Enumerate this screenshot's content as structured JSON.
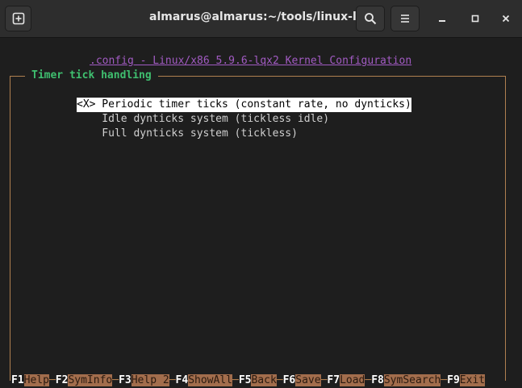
{
  "header": {
    "title": "almarus@almarus:~/tools/linux-lqx"
  },
  "terminal": {
    "config_title": ".config - Linux/x86 5.9.6-lqx2 Kernel Configuration",
    "box_title": "Timer tick handling",
    "options": [
      {
        "text": "<X> Periodic timer ticks (constant rate, no dynticks)",
        "selected": true
      },
      {
        "text": "    Idle dynticks system (tickless idle)",
        "selected": false
      },
      {
        "text": "    Full dynticks system (tickless)",
        "selected": false
      }
    ],
    "function_keys": [
      {
        "key": "F1",
        "label": "Help"
      },
      {
        "key": "F2",
        "label": "SymInfo"
      },
      {
        "key": "F3",
        "label": "Help 2"
      },
      {
        "key": "F4",
        "label": "ShowAll"
      },
      {
        "key": "F5",
        "label": "Back"
      },
      {
        "key": "F6",
        "label": "Save"
      },
      {
        "key": "F7",
        "label": "Load"
      },
      {
        "key": "F8",
        "label": "SymSearch"
      },
      {
        "key": "F9",
        "label": "Exit"
      }
    ]
  },
  "colors": {
    "config_title": "#a25bc3",
    "box_title": "#3fbf6f",
    "border": "#b08050",
    "fkey_label_bg": "#a26d4c",
    "background": "#1e1e1e"
  },
  "icons": {
    "new_tab": "new-tab-icon",
    "search": "search-icon",
    "menu": "hamburger-menu-icon",
    "minimize": "minimize-icon",
    "maximize": "maximize-icon",
    "close": "close-icon"
  }
}
